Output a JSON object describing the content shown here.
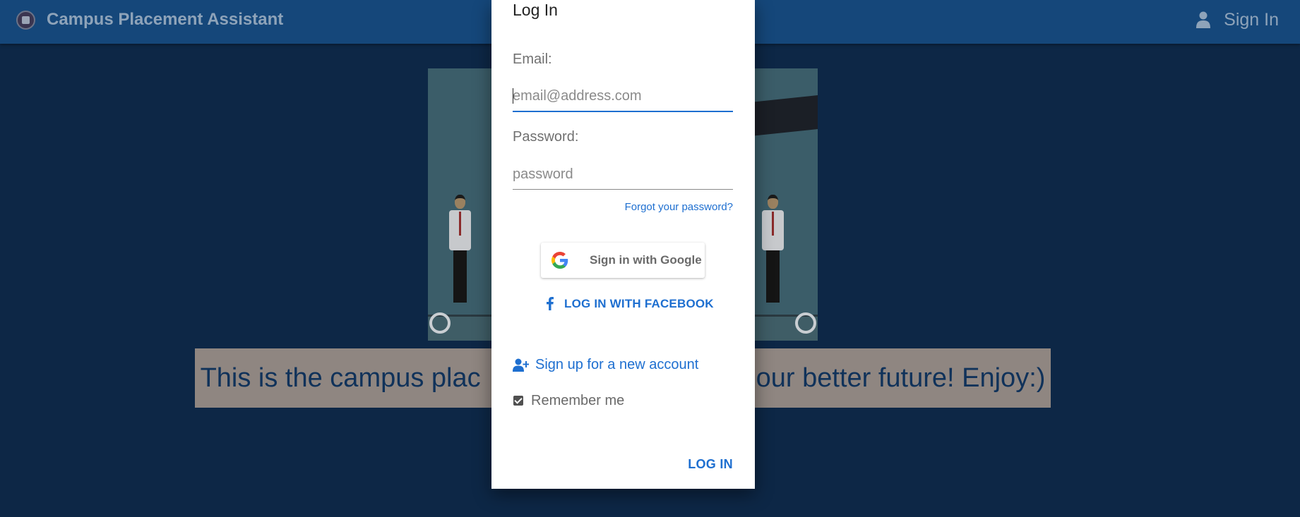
{
  "header": {
    "title": "Campus Placement Assistant",
    "signin_label": "Sign In",
    "logo_icon": "college-emblem-icon",
    "user_icon": "user-icon"
  },
  "main": {
    "tagline_left": "This is the campus plac",
    "tagline_right": "our better future! Enjoy:)"
  },
  "login_dialog": {
    "title": "Log In",
    "email": {
      "label": "Email:",
      "placeholder": "email@address.com",
      "value": ""
    },
    "password": {
      "label": "Password:",
      "placeholder": "password",
      "value": ""
    },
    "forgot_password": "Forgot your password?",
    "google_button": "Sign in with Google",
    "facebook_button": "LOG IN WITH FACEBOOK",
    "signup_link": "Sign up for a new account",
    "remember_me": {
      "label": "Remember me",
      "checked": true
    },
    "submit": "LOG IN"
  },
  "colors": {
    "header_bg": "#15477a",
    "page_bg": "#0d2746",
    "accent": "#1e6fd0",
    "tagline_bg": "#8f8681"
  }
}
